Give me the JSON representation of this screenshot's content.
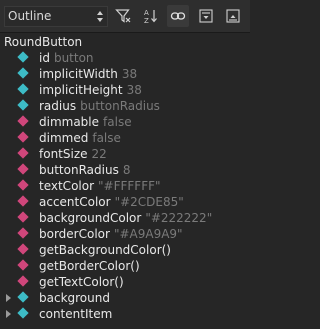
{
  "toolbar": {
    "view_combo": "Outline",
    "icons": [
      "combo-arrows-icon",
      "filter-icon",
      "sort-icon",
      "link-icon",
      "expand-icon",
      "collapse-icon"
    ]
  },
  "tree": {
    "root": "RoundButton",
    "items": [
      {
        "name": "id",
        "value": "button",
        "kind": "teal"
      },
      {
        "name": "implicitWidth",
        "value": "38",
        "kind": "teal"
      },
      {
        "name": "implicitHeight",
        "value": "38",
        "kind": "teal"
      },
      {
        "name": "radius",
        "value": "buttonRadius",
        "kind": "teal"
      },
      {
        "name": "dimmable",
        "value": "false",
        "kind": "pink"
      },
      {
        "name": "dimmed",
        "value": "false",
        "kind": "pink"
      },
      {
        "name": "fontSize",
        "value": "22",
        "kind": "pink"
      },
      {
        "name": "buttonRadius",
        "value": "8",
        "kind": "pink"
      },
      {
        "name": "textColor",
        "value": "\"#FFFFFF\"",
        "kind": "pink"
      },
      {
        "name": "accentColor",
        "value": "\"#2CDE85\"",
        "kind": "pink"
      },
      {
        "name": "backgroundColor",
        "value": "\"#222222\"",
        "kind": "pink"
      },
      {
        "name": "borderColor",
        "value": "\"#A9A9A9\"",
        "kind": "pink"
      },
      {
        "name": "getBackgroundColor()",
        "value": "",
        "kind": "pink"
      },
      {
        "name": "getBorderColor()",
        "value": "",
        "kind": "pink"
      },
      {
        "name": "getTextColor()",
        "value": "",
        "kind": "pink"
      },
      {
        "name": "background",
        "value": "",
        "kind": "teal",
        "expandable": true
      },
      {
        "name": "contentItem",
        "value": "",
        "kind": "teal",
        "expandable": true
      }
    ]
  },
  "colors": {
    "teal": "#3dbcc6",
    "pink": "#d0467b",
    "value_gray": "#7a7a7a"
  }
}
